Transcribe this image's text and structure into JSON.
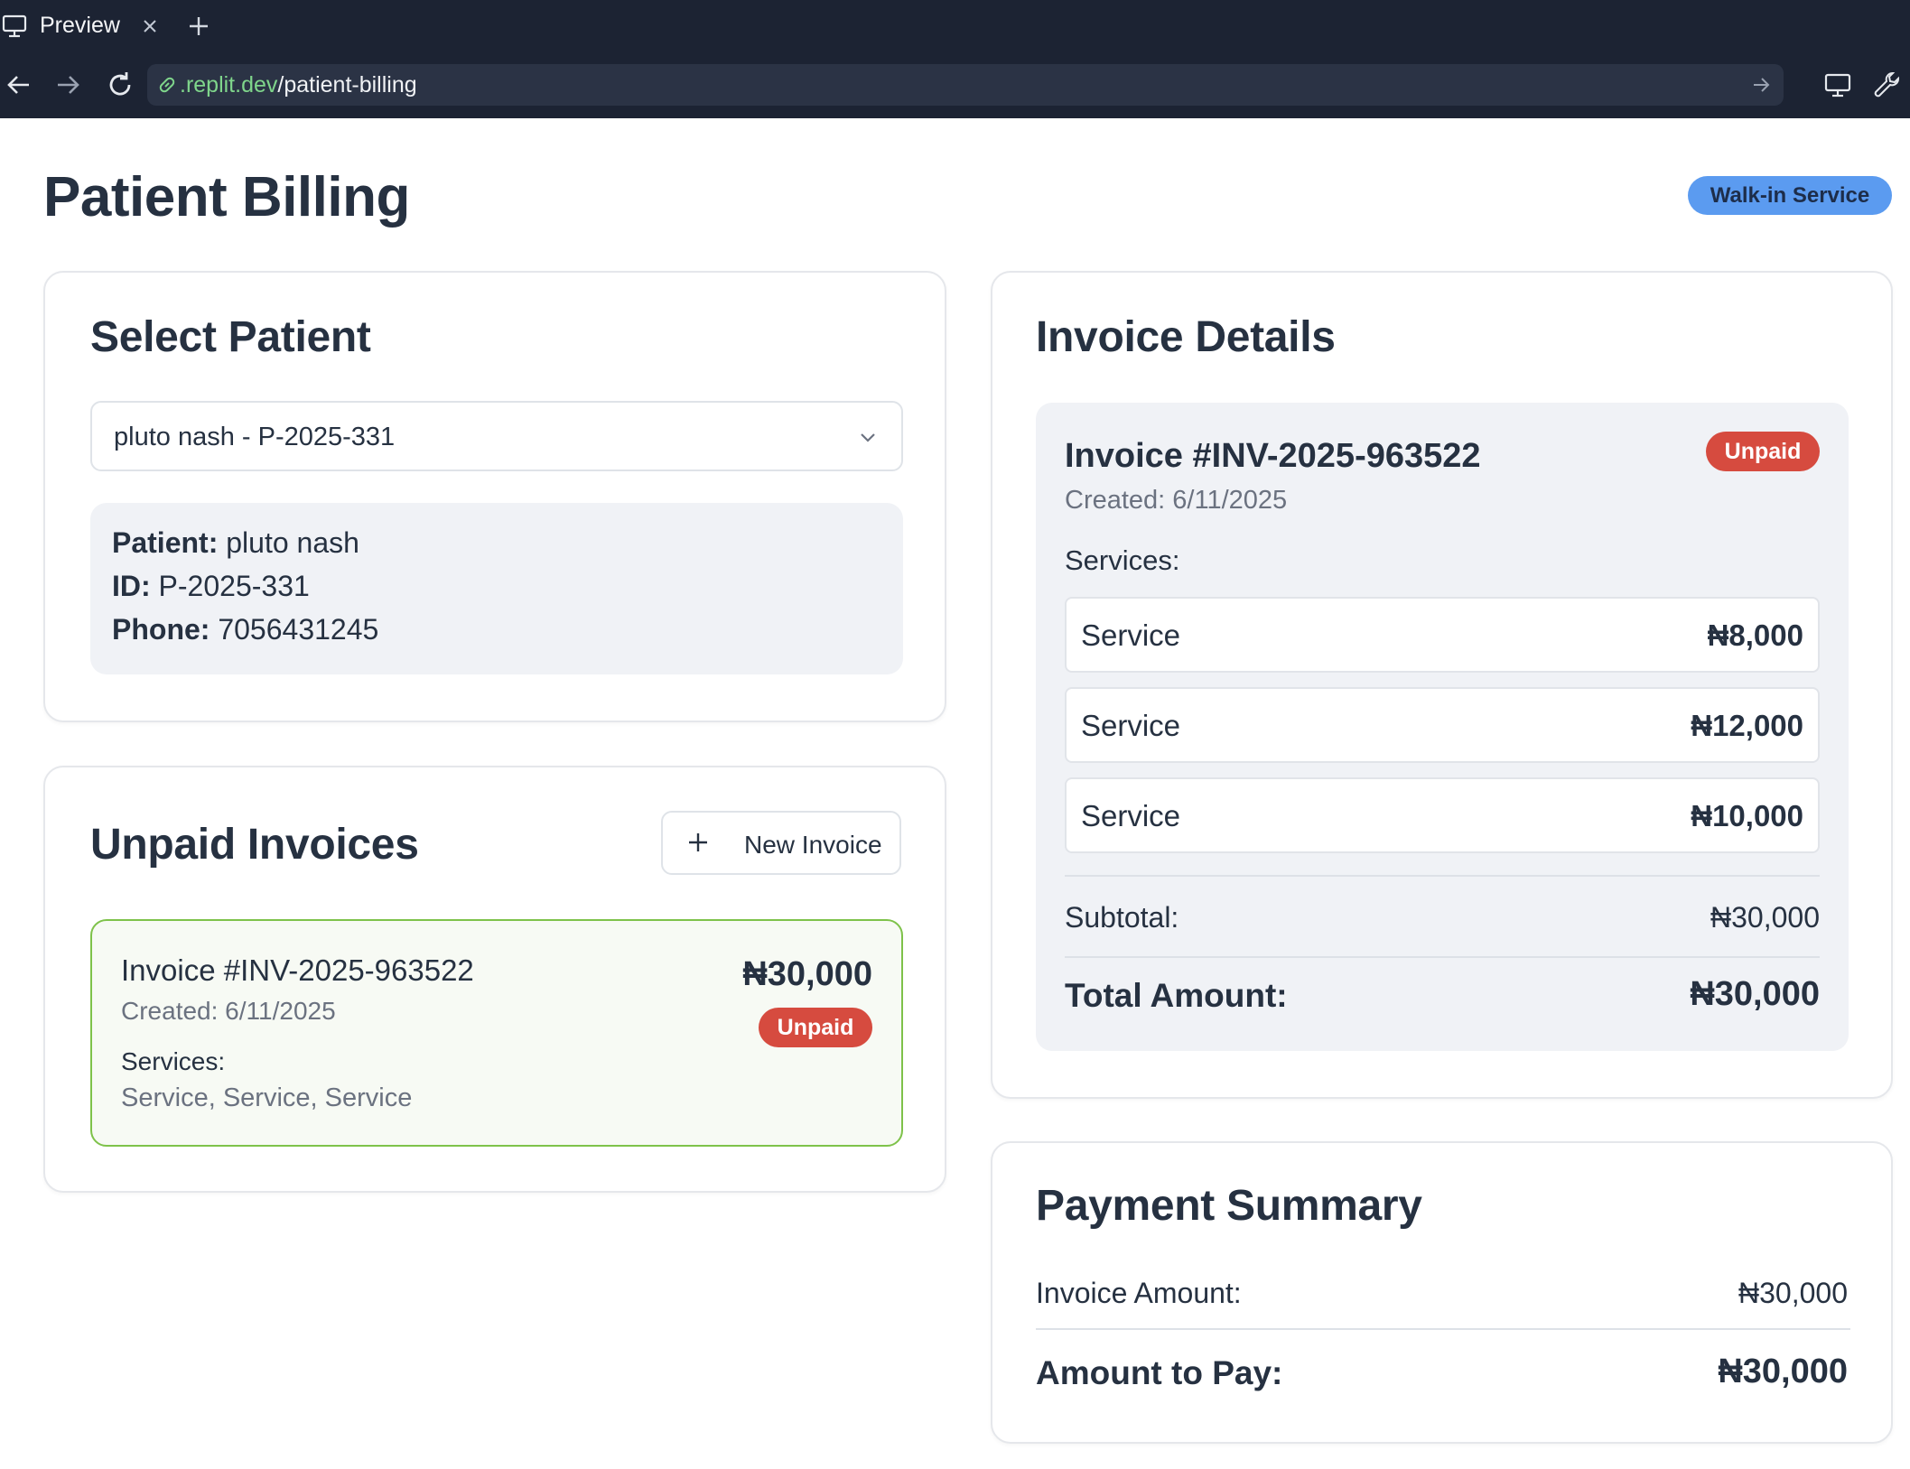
{
  "browser": {
    "tab_title": "Preview",
    "url_host": ".replit.dev",
    "url_path": "/patient-billing"
  },
  "header": {
    "title": "Patient Billing",
    "badge": "Walk-in Service"
  },
  "select_patient": {
    "title": "Select Patient",
    "selected_value": "pluto nash - P-2025-331",
    "patient_label": "Patient:",
    "patient_value": " pluto nash",
    "id_label": "ID:",
    "id_value": " P-2025-331",
    "phone_label": "Phone:",
    "phone_value": " 7056431245"
  },
  "unpaid_invoices": {
    "title": "Unpaid Invoices",
    "new_invoice_label": "New Invoice",
    "items": [
      {
        "title": "Invoice #INV-2025-963522",
        "created": "Created: 6/11/2025",
        "services_label": "Services:",
        "services": "Service, Service, Service",
        "amount": "₦30,000",
        "status": "Unpaid"
      }
    ]
  },
  "invoice_details": {
    "title": "Invoice Details",
    "invoice_title": "Invoice #INV-2025-963522",
    "created": "Created: 6/11/2025",
    "status": "Unpaid",
    "services_label": "Services:",
    "services": [
      {
        "name": "Service",
        "price": "₦8,000"
      },
      {
        "name": "Service",
        "price": "₦12,000"
      },
      {
        "name": "Service",
        "price": "₦10,000"
      }
    ],
    "subtotal_label": "Subtotal:",
    "subtotal_value": "₦30,000",
    "total_label": "Total Amount:",
    "total_value": "₦30,000"
  },
  "payment_summary": {
    "title": "Payment Summary",
    "invoice_amount_label": "Invoice Amount:",
    "invoice_amount_value": "₦30,000",
    "amount_to_pay_label": "Amount to Pay:",
    "amount_to_pay_value": "₦30,000"
  },
  "colors": {
    "chrome_bg": "#1c2333",
    "url_host": "#7fd58b",
    "badge_blue": "#5b9bf0",
    "unpaid_red": "#d64b3f",
    "selected_border_green": "#7ec24a"
  },
  "icons": [
    "monitor-icon",
    "close-icon",
    "plus-icon",
    "arrow-left-icon",
    "arrow-right-icon",
    "reload-icon",
    "link-icon",
    "go-arrow-icon",
    "devices-icon",
    "wrench-icon",
    "chevron-down-icon"
  ]
}
